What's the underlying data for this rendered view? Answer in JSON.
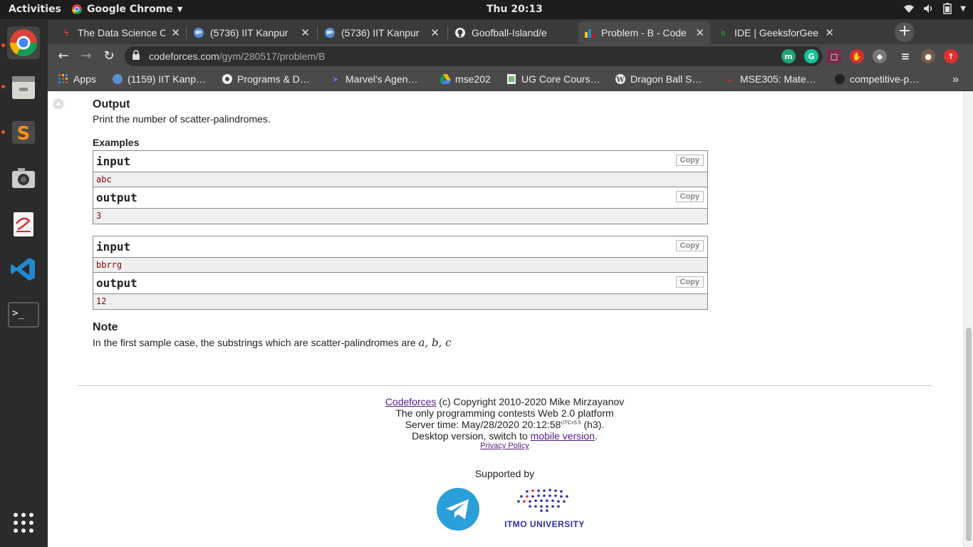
{
  "topbar": {
    "activities": "Activities",
    "app_name": "Google Chrome",
    "clock": "Thu 20:13"
  },
  "dock": [
    "chrome-icon",
    "files-icon",
    "sublime-text-icon",
    "camera-icon",
    "document-viewer-icon",
    "vscode-icon",
    "terminal-icon",
    "app-grid-icon"
  ],
  "tabs": [
    {
      "title": "The Data Science C",
      "icon": "datascience-icon"
    },
    {
      "title": "(5736) IIT Kanpur",
      "icon": "globe-icon"
    },
    {
      "title": "(5736) IIT Kanpur",
      "icon": "globe-icon"
    },
    {
      "title": "Goofball-Island/e",
      "icon": "github-icon"
    },
    {
      "title": "Problem - B - Code",
      "icon": "codeforces-icon"
    },
    {
      "title": "IDE | GeeksforGee",
      "icon": "gfg-icon"
    }
  ],
  "omnibox": {
    "domain": "codeforces.com",
    "path": "/gym/280517/problem/B"
  },
  "bookmarks": [
    {
      "label": "Apps"
    },
    {
      "label": "(1159) IIT Kanp…"
    },
    {
      "label": "Programs & D…"
    },
    {
      "label": "Marvel's Agen…"
    },
    {
      "label": "mse202"
    },
    {
      "label": "UG Core Cours…"
    },
    {
      "label": "Dragon Ball S…"
    },
    {
      "label": "MSE305: Mate…"
    },
    {
      "label": "competitive-p…"
    }
  ],
  "bookmarks_more": "»",
  "problem": {
    "output_title": "Output",
    "output_text": "Print the number of scatter-palindromes.",
    "examples_title": "Examples",
    "copy_label": "Copy",
    "input_label": "input",
    "output_label": "output",
    "samples": [
      {
        "input": "abc",
        "output": "3"
      },
      {
        "input": "bbrrg",
        "output": "12"
      }
    ],
    "note_title": "Note",
    "note_text": "In the first sample case, the substrings which are scatter-palindromes are",
    "note_math": "a, b, c"
  },
  "footer": {
    "codeforces_link": "Codeforces",
    "copyright": " (c) Copyright 2010-2020 Mike Mirzayanov",
    "tagline": "The only programming contests Web 2.0 platform",
    "server_time_prefix": "Server time: May/28/2020 20:12:58",
    "server_time_tz": "UTC+5.5",
    "server_time_suffix": " (h3).",
    "desktop_prefix": "Desktop version, switch to ",
    "mobile_link": "mobile version",
    "desktop_suffix": ".",
    "privacy": "Privacy Policy",
    "supported_by": "Supported by",
    "itmo": "ITMO UNIVERSITY"
  }
}
